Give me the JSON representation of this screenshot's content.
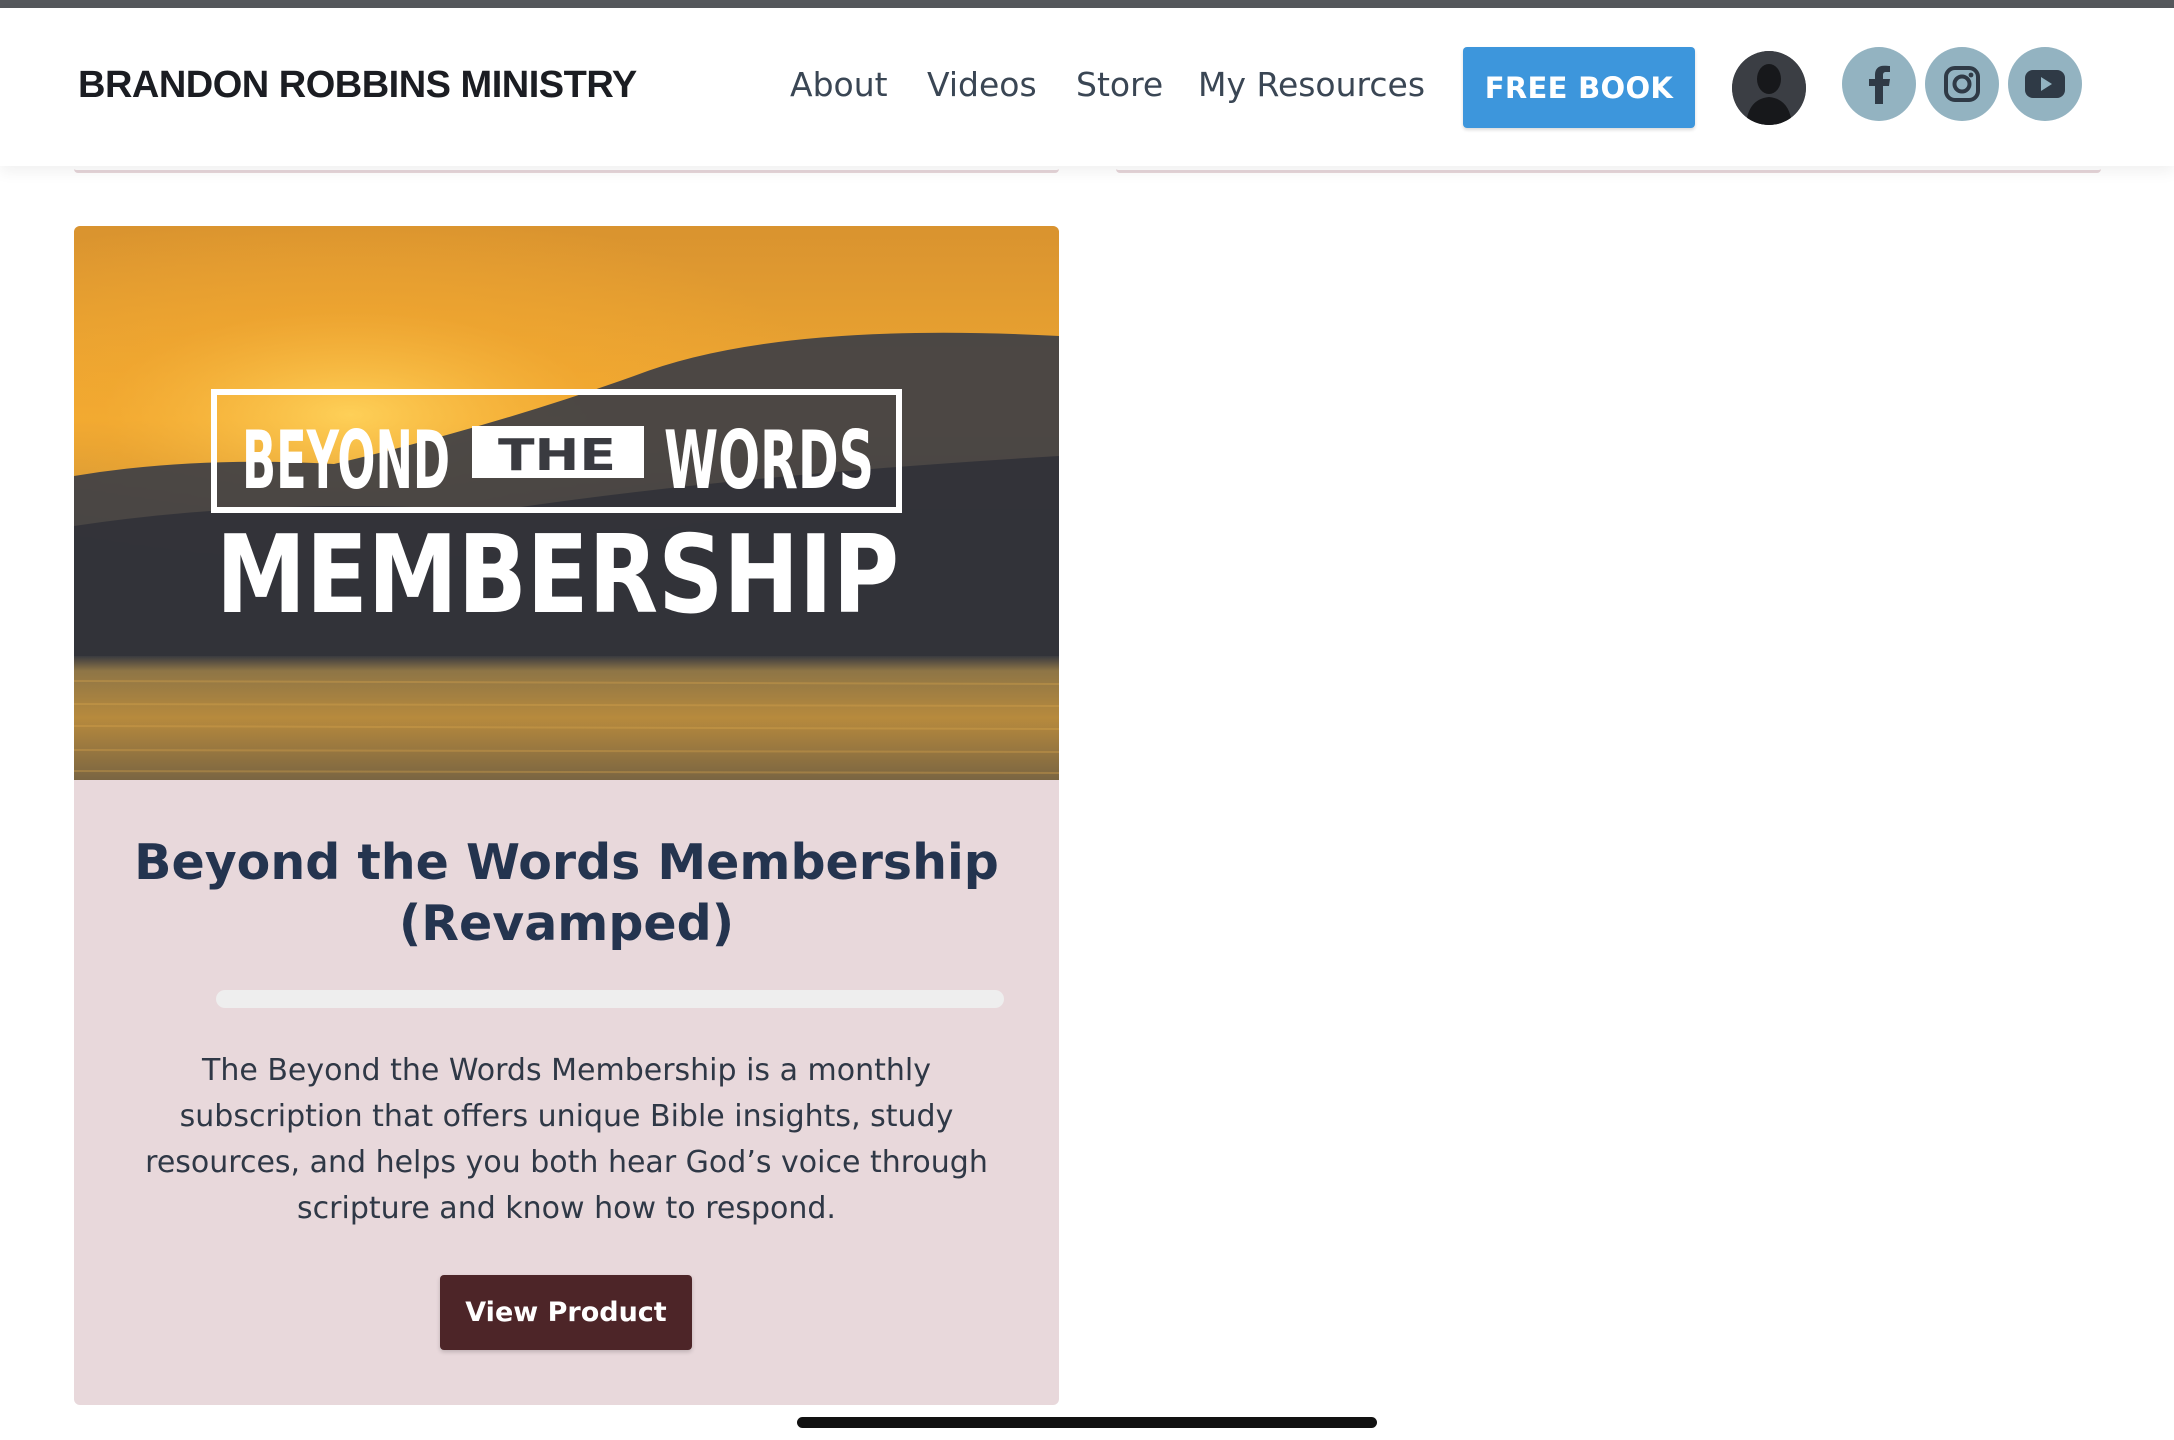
{
  "header": {
    "brand": "BRANDON ROBBINS MINISTRY",
    "nav": [
      "About",
      "Videos",
      "Store",
      "My Resources"
    ],
    "cta_label": "FREE BOOK",
    "social_icons": [
      "facebook-icon",
      "instagram-icon",
      "youtube-icon"
    ]
  },
  "product": {
    "image_text": {
      "line1_left": "BEYOND",
      "line1_mid": "THE",
      "line1_right": "WORDS",
      "line2": "MEMBERSHIP"
    },
    "title": "Beyond the Words Membership (Revamped)",
    "progress": 0,
    "description": "The Beyond the Words Membership is a monthly subscription that offers unique Bible insights, study resources, and helps you both hear God’s voice through scripture and know how to respond.",
    "button_label": "View Product"
  },
  "colors": {
    "accent": "#3d96dc",
    "card_bg": "#e8d8db",
    "title": "#24344f",
    "button": "#4d2528",
    "social_bg": "#93b3c1"
  }
}
